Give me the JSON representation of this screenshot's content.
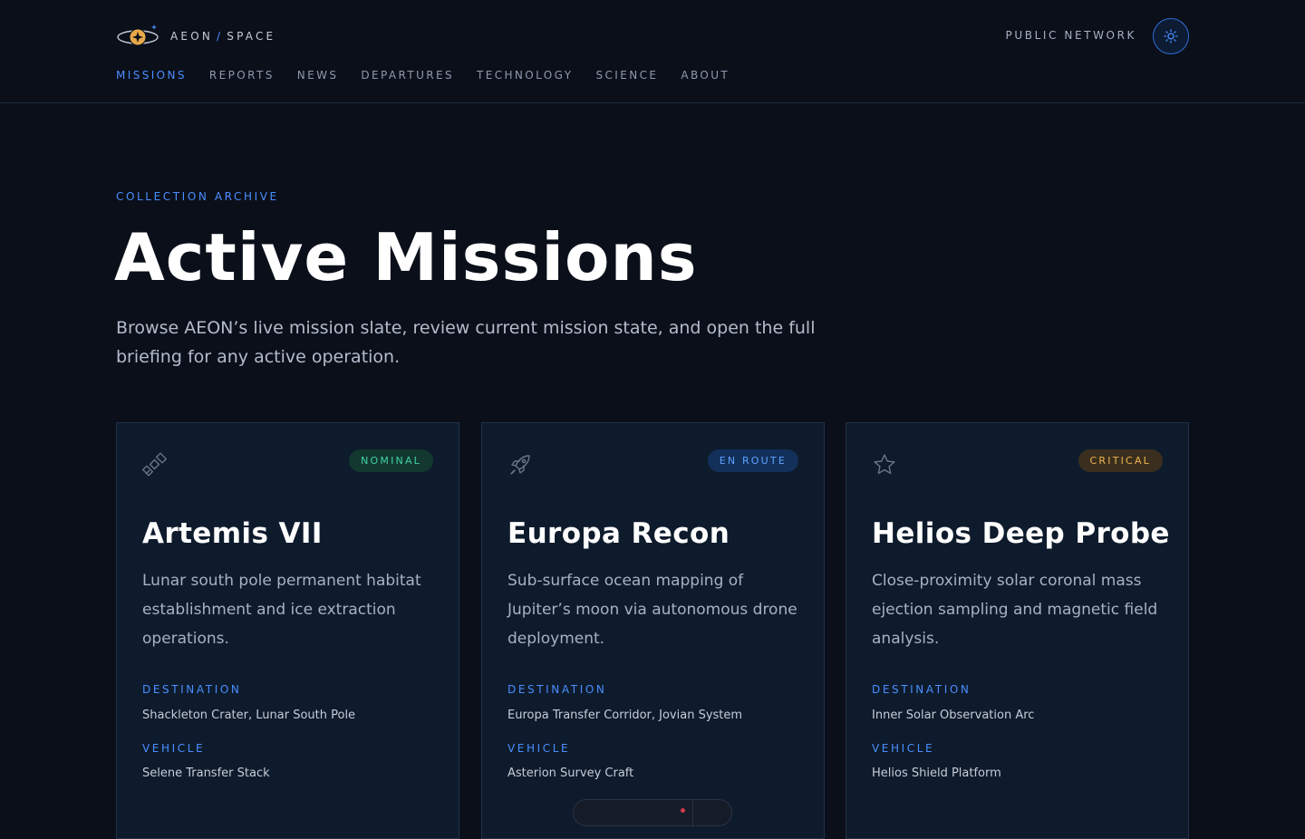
{
  "brand": {
    "name_left": "AEON",
    "separator": "/",
    "name_right": "SPACE",
    "icon": "planet-ring-icon"
  },
  "header": {
    "network_label": "PUBLIC NETWORK",
    "theme_icon": "sun-icon"
  },
  "nav": {
    "items": [
      {
        "label": "MISSIONS",
        "active": true
      },
      {
        "label": "REPORTS"
      },
      {
        "label": "NEWS"
      },
      {
        "label": "DEPARTURES"
      },
      {
        "label": "TECHNOLOGY"
      },
      {
        "label": "SCIENCE"
      },
      {
        "label": "ABOUT"
      }
    ]
  },
  "hero": {
    "eyebrow": "COLLECTION ARCHIVE",
    "title": "Active Missions",
    "description": "Browse AEON’s live mission slate, review current mission state, and open the full briefing for any active operation."
  },
  "missions": [
    {
      "icon": "satellite-icon",
      "status": "NOMINAL",
      "title": "Artemis VII",
      "description": "Lunar south pole permanent habitat establishment and ice extraction operations.",
      "destination_label": "DESTINATION",
      "destination": "Shackleton Crater, Lunar South Pole",
      "vehicle_label": "VEHICLE",
      "vehicle": "Selene Transfer Stack"
    },
    {
      "icon": "rocket-icon",
      "status": "EN ROUTE",
      "title": "Europa Recon",
      "description": "Sub-surface ocean mapping of Jupiter’s moon via autonomous drone deployment.",
      "destination_label": "DESTINATION",
      "destination": "Europa Transfer Corridor, Jovian System",
      "vehicle_label": "VEHICLE",
      "vehicle": "Asterion Survey Craft"
    },
    {
      "icon": "star-icon",
      "status": "CRITICAL",
      "title": "Helios Deep Probe",
      "description": "Close-proximity solar coronal mass ejection sampling and magnetic field analysis.",
      "destination_label": "DESTINATION",
      "destination": "Inner Solar Observation Arc",
      "vehicle_label": "VEHICLE",
      "vehicle": "Helios Shield Platform"
    }
  ],
  "colors": {
    "accent": "#4a8eff",
    "nominal": "#3fd4a0",
    "en_route": "#5ea2ff",
    "critical": "#f0b450",
    "background": "#0a0f1a"
  }
}
